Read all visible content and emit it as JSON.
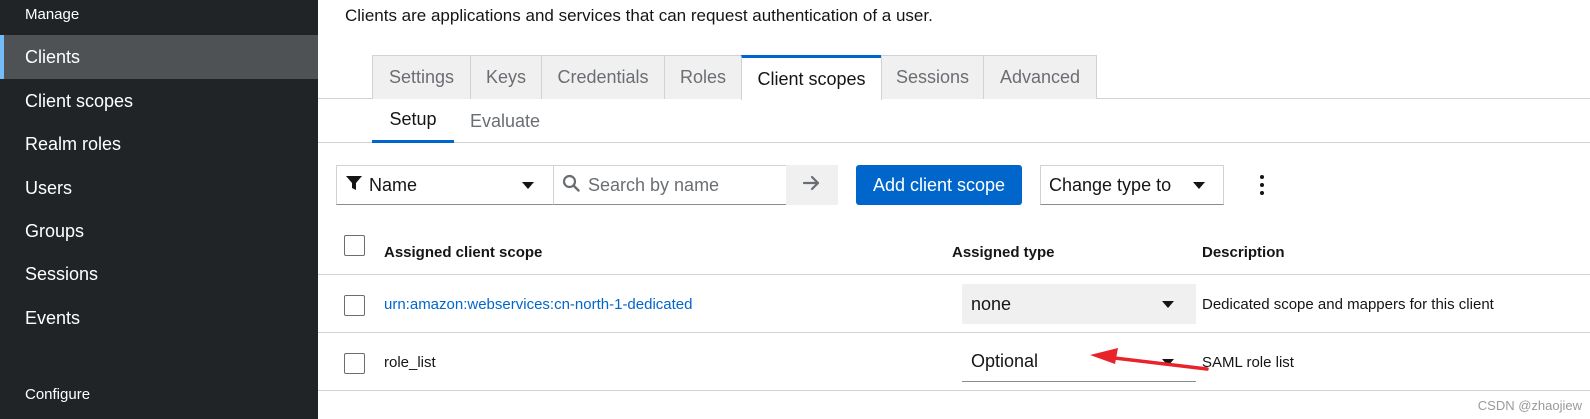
{
  "sidebar": {
    "section_manage": "Manage",
    "items": [
      {
        "label": "Clients",
        "active": true
      },
      {
        "label": "Client scopes"
      },
      {
        "label": "Realm roles"
      },
      {
        "label": "Users"
      },
      {
        "label": "Groups"
      },
      {
        "label": "Sessions"
      },
      {
        "label": "Events"
      }
    ],
    "section_configure": "Configure"
  },
  "main": {
    "description": "Clients are applications and services that can request authentication of a user.",
    "tabs": [
      {
        "label": "Settings"
      },
      {
        "label": "Keys"
      },
      {
        "label": "Credentials"
      },
      {
        "label": "Roles"
      },
      {
        "label": "Client scopes",
        "active": true
      },
      {
        "label": "Sessions"
      },
      {
        "label": "Advanced"
      }
    ],
    "subtabs": [
      {
        "label": "Setup",
        "active": true
      },
      {
        "label": "Evaluate"
      }
    ]
  },
  "toolbar": {
    "filter_label": "Name",
    "search_placeholder": "Search by name",
    "add_button": "Add client scope",
    "change_type": "Change type to"
  },
  "table": {
    "headers": {
      "scope": "Assigned client scope",
      "type": "Assigned type",
      "description": "Description"
    },
    "rows": [
      {
        "scope": "urn:amazon:webservices:cn-north-1-dedicated",
        "type": "none",
        "description": "Dedicated scope and mappers for this client",
        "link": true
      },
      {
        "scope": "role_list",
        "type": "Optional",
        "description": "SAML role list",
        "link": false
      }
    ]
  },
  "annotation": {
    "color": "#e8232a"
  },
  "watermark": "CSDN @zhaojiew",
  "colors": {
    "sidebar_bg": "#212427",
    "accent": "#0066cc",
    "active_item_bg": "#4f5255"
  }
}
